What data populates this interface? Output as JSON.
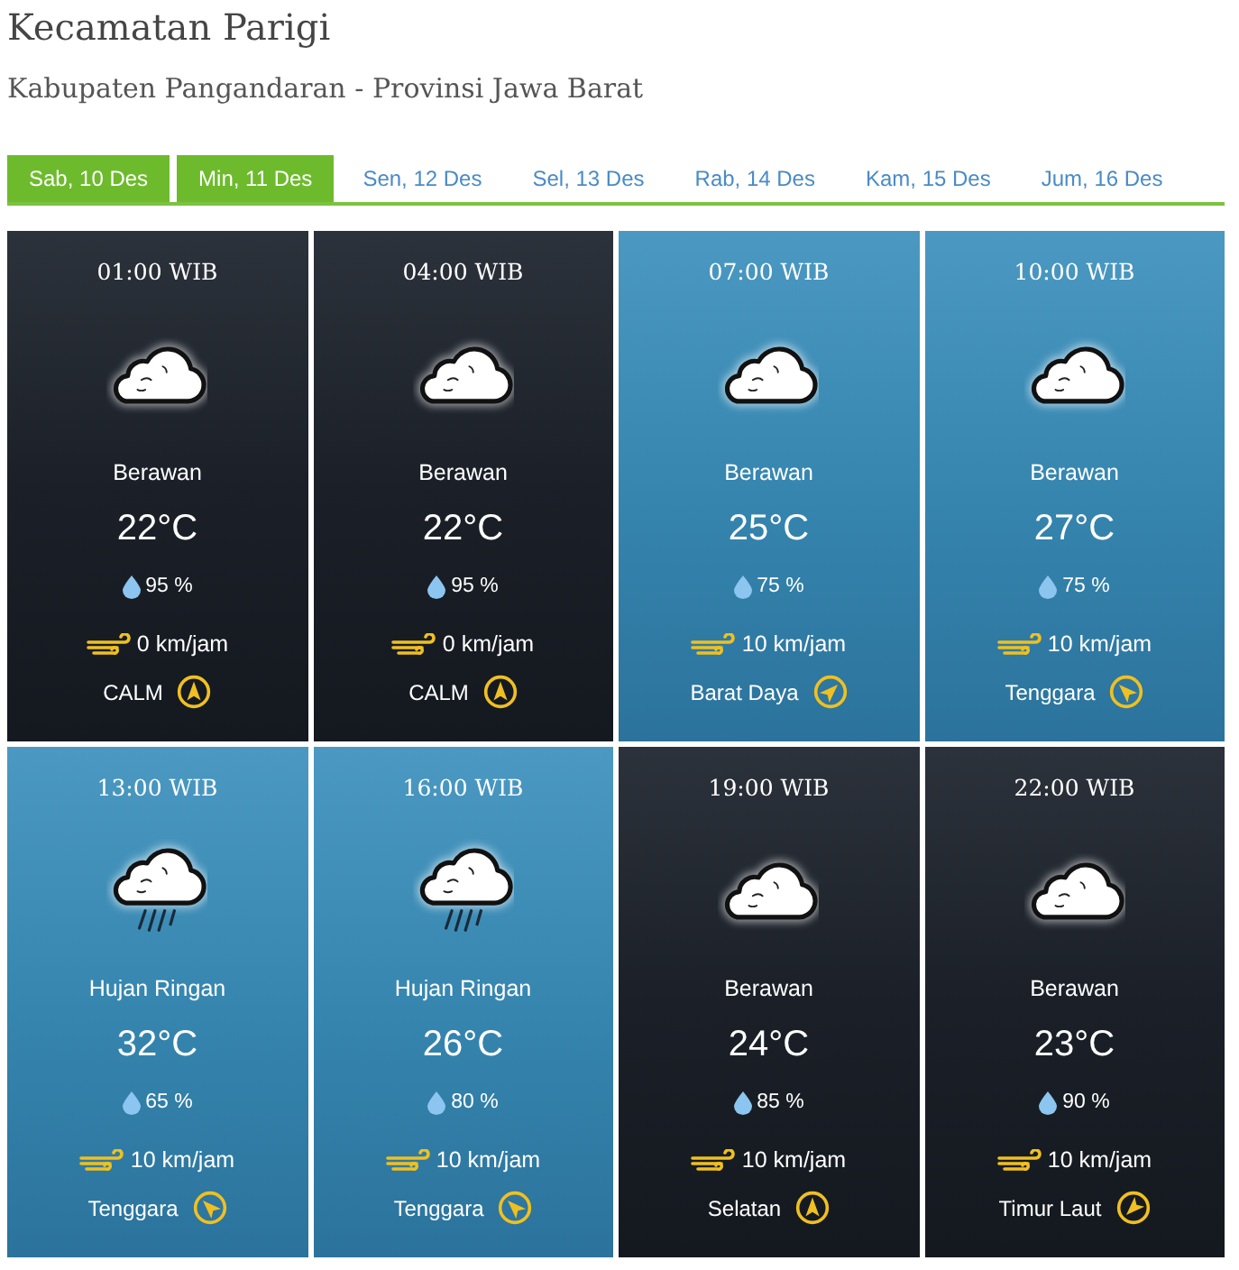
{
  "location": {
    "title": "Kecamatan Parigi",
    "subtitle": "Kabupaten Pangandaran - Provinsi Jawa Barat"
  },
  "tabs": [
    {
      "label": "Sab, 10 Des",
      "selected": true
    },
    {
      "label": "Min, 11 Des",
      "selected": true
    },
    {
      "label": "Sen, 12 Des",
      "selected": false
    },
    {
      "label": "Sel, 13 Des",
      "selected": false
    },
    {
      "label": "Rab, 14 Des",
      "selected": false
    },
    {
      "label": "Kam, 15 Des",
      "selected": false
    },
    {
      "label": "Jum, 16 Des",
      "selected": false
    }
  ],
  "cards": [
    {
      "time": "01:00 WIB",
      "kind": "night",
      "rain": false,
      "condition": "Berawan",
      "temperature": "22°C",
      "humidity": "95 %",
      "wind_speed": "0 km/jam",
      "wind_direction": "CALM",
      "compass": {
        "kind": "north"
      }
    },
    {
      "time": "04:00 WIB",
      "kind": "night",
      "rain": false,
      "condition": "Berawan",
      "temperature": "22°C",
      "humidity": "95 %",
      "wind_speed": "0 km/jam",
      "wind_direction": "CALM",
      "compass": {
        "kind": "north"
      }
    },
    {
      "time": "07:00 WIB",
      "kind": "day",
      "rain": false,
      "condition": "Berawan",
      "temperature": "25°C",
      "humidity": "75 %",
      "wind_speed": "10 km/jam",
      "wind_direction": "Barat Daya",
      "compass": {
        "kind": "northeast"
      }
    },
    {
      "time": "10:00 WIB",
      "kind": "day",
      "rain": false,
      "condition": "Berawan",
      "temperature": "27°C",
      "humidity": "75 %",
      "wind_speed": "10 km/jam",
      "wind_direction": "Tenggara",
      "compass": {
        "kind": "northwest"
      }
    },
    {
      "time": "13:00 WIB",
      "kind": "day",
      "rain": true,
      "condition": "Hujan Ringan",
      "temperature": "32°C",
      "humidity": "65 %",
      "wind_speed": "10 km/jam",
      "wind_direction": "Tenggara",
      "compass": {
        "kind": "northwest"
      }
    },
    {
      "time": "16:00 WIB",
      "kind": "day",
      "rain": true,
      "condition": "Hujan Ringan",
      "temperature": "26°C",
      "humidity": "80 %",
      "wind_speed": "10 km/jam",
      "wind_direction": "Tenggara",
      "compass": {
        "kind": "northwest"
      }
    },
    {
      "time": "19:00 WIB",
      "kind": "night",
      "rain": false,
      "condition": "Berawan",
      "temperature": "24°C",
      "humidity": "85 %",
      "wind_speed": "10 km/jam",
      "wind_direction": "Selatan",
      "compass": {
        "kind": "north"
      }
    },
    {
      "time": "22:00 WIB",
      "kind": "night",
      "rain": false,
      "condition": "Berawan",
      "temperature": "23°C",
      "humidity": "90 %",
      "wind_speed": "10 km/jam",
      "wind_direction": "Timur Laut",
      "compass": {
        "kind": "southwest"
      }
    }
  ]
}
